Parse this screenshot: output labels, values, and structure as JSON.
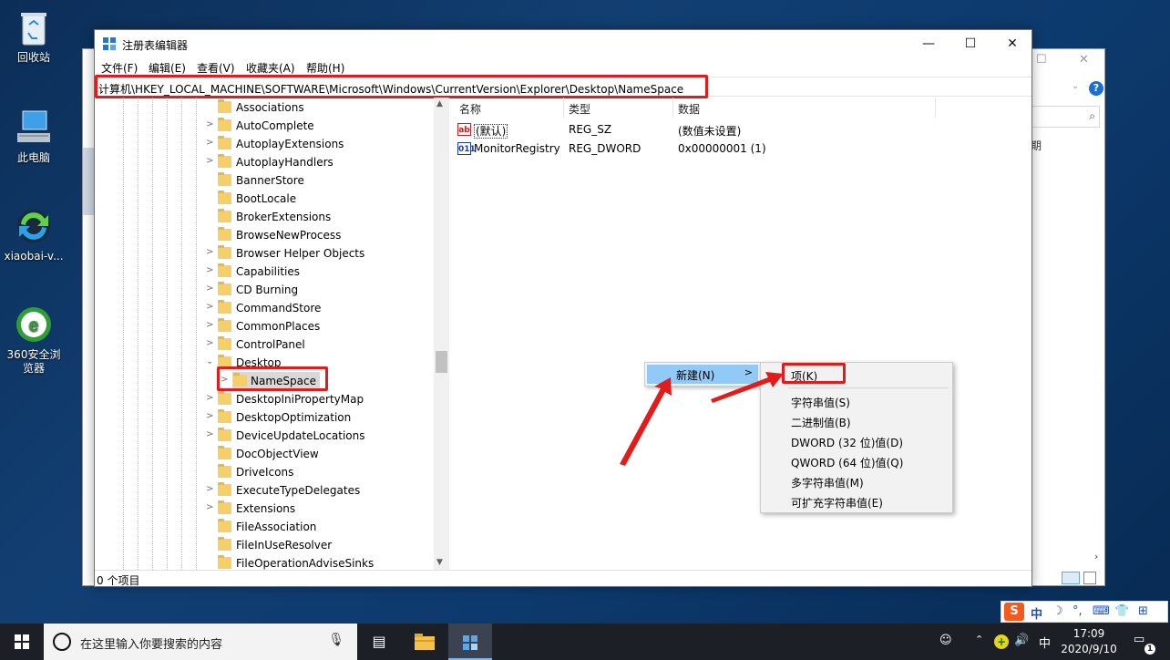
{
  "desktop": {
    "icons": [
      {
        "label": "回收站",
        "icon": "recycle-bin-icon"
      },
      {
        "label": "此电脑",
        "icon": "computer-icon"
      },
      {
        "label": "xiaobai-v...",
        "icon": "xiaobai-icon"
      },
      {
        "label": "360安全浏览器",
        "icon": "browser-360-icon"
      }
    ]
  },
  "background_window": {
    "partial_text": "期",
    "help_glyph": "?"
  },
  "regedit": {
    "title": "注册表编辑器",
    "menu": [
      "文件(F)",
      "编辑(E)",
      "查看(V)",
      "收藏夹(A)",
      "帮助(H)"
    ],
    "address": "计算机\\HKEY_LOCAL_MACHINE\\SOFTWARE\\Microsoft\\Windows\\CurrentVersion\\Explorer\\Desktop\\NameSpace",
    "tree": [
      {
        "label": "Associations",
        "expander": ""
      },
      {
        "label": "AutoComplete",
        "expander": ">"
      },
      {
        "label": "AutoplayExtensions",
        "expander": ">"
      },
      {
        "label": "AutoplayHandlers",
        "expander": ">"
      },
      {
        "label": "BannerStore",
        "expander": ""
      },
      {
        "label": "BootLocale",
        "expander": ""
      },
      {
        "label": "BrokerExtensions",
        "expander": ""
      },
      {
        "label": "BrowseNewProcess",
        "expander": ""
      },
      {
        "label": "Browser Helper Objects",
        "expander": ">"
      },
      {
        "label": "Capabilities",
        "expander": ">"
      },
      {
        "label": "CD Burning",
        "expander": ">"
      },
      {
        "label": "CommandStore",
        "expander": ">"
      },
      {
        "label": "CommonPlaces",
        "expander": ">"
      },
      {
        "label": "ControlPanel",
        "expander": ">"
      },
      {
        "label": "Desktop",
        "expander": "v"
      },
      {
        "label": "NameSpace",
        "expander": ">",
        "child": true,
        "selected": true
      },
      {
        "label": "DesktopIniPropertyMap",
        "expander": ">"
      },
      {
        "label": "DesktopOptimization",
        "expander": ">"
      },
      {
        "label": "DeviceUpdateLocations",
        "expander": ">"
      },
      {
        "label": "DocObjectView",
        "expander": ""
      },
      {
        "label": "DriveIcons",
        "expander": ""
      },
      {
        "label": "ExecuteTypeDelegates",
        "expander": ">"
      },
      {
        "label": "Extensions",
        "expander": ">"
      },
      {
        "label": "FileAssociation",
        "expander": ""
      },
      {
        "label": "FileInUseResolver",
        "expander": ""
      },
      {
        "label": "FileOperationAdviseSinks",
        "expander": ""
      }
    ],
    "list_headers": [
      "名称",
      "类型",
      "数据"
    ],
    "values": [
      {
        "name": "(默认)",
        "type": "REG_SZ",
        "data": "(数值未设置)",
        "icon": "ab"
      },
      {
        "name": "MonitorRegistry",
        "type": "REG_DWORD",
        "data": "0x00000001 (1)",
        "icon": "011"
      }
    ],
    "status": "0 个项目"
  },
  "context_menu": {
    "new_label": "新建(N)",
    "new_arrow": ">",
    "submenu": [
      "项(K)",
      "字符串值(S)",
      "二进制值(B)",
      "DWORD (32 位)值(D)",
      "QWORD (64 位)值(Q)",
      "多字符串值(M)",
      "可扩充字符串值(E)"
    ]
  },
  "ime": {
    "logo": "S",
    "mode": "中",
    "items": [
      "☽",
      "°,",
      "⌨",
      "👕",
      "⊞"
    ]
  },
  "taskbar": {
    "search_placeholder": "在这里输入你要搜索的内容",
    "tray_lang": "中",
    "time": "17:09",
    "date": "2020/9/10",
    "notification_count": "1"
  },
  "annotation_color": "#e21b1b"
}
